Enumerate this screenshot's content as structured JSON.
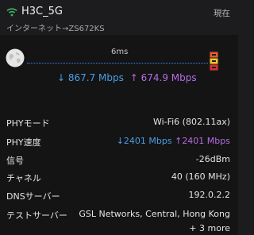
{
  "header": {
    "ssid": "H3C_5G",
    "route": "インターネット→ZS672KS",
    "status_time": "現在"
  },
  "test": {
    "latency": "6ms",
    "download_arrow": "↓",
    "download": "867.7 Mbps",
    "upload_arrow": "↑",
    "upload": "674.9 Mbps"
  },
  "details": {
    "phy_mode": {
      "label": "PHYモード",
      "value": "Wi-Fi6 (802.11ax)"
    },
    "phy_speed": {
      "label": "PHY速度",
      "down_arrow": "↓",
      "down": "2401 Mbps",
      "up_arrow": "↑",
      "up": "2401 Mbps"
    },
    "signal": {
      "label": "信号",
      "value": "-26dBm"
    },
    "channel": {
      "label": "チャネル",
      "value": "40 (160 MHz)"
    },
    "dns": {
      "label": "DNSサーバー",
      "value": "192.0.2.2"
    },
    "test_server": {
      "label": "テストサーバー",
      "value": "GSL Networks, Central, Hong Kong",
      "more": "+ 3 more"
    }
  },
  "colors": {
    "background": "#1c1c1e",
    "panel": "#141414",
    "download": "#4a9fe8",
    "upload": "#b66be3",
    "signal_good": "#3db55e"
  },
  "icons": [
    "wifi-icon",
    "globe-icon",
    "server-logo-icon"
  ]
}
